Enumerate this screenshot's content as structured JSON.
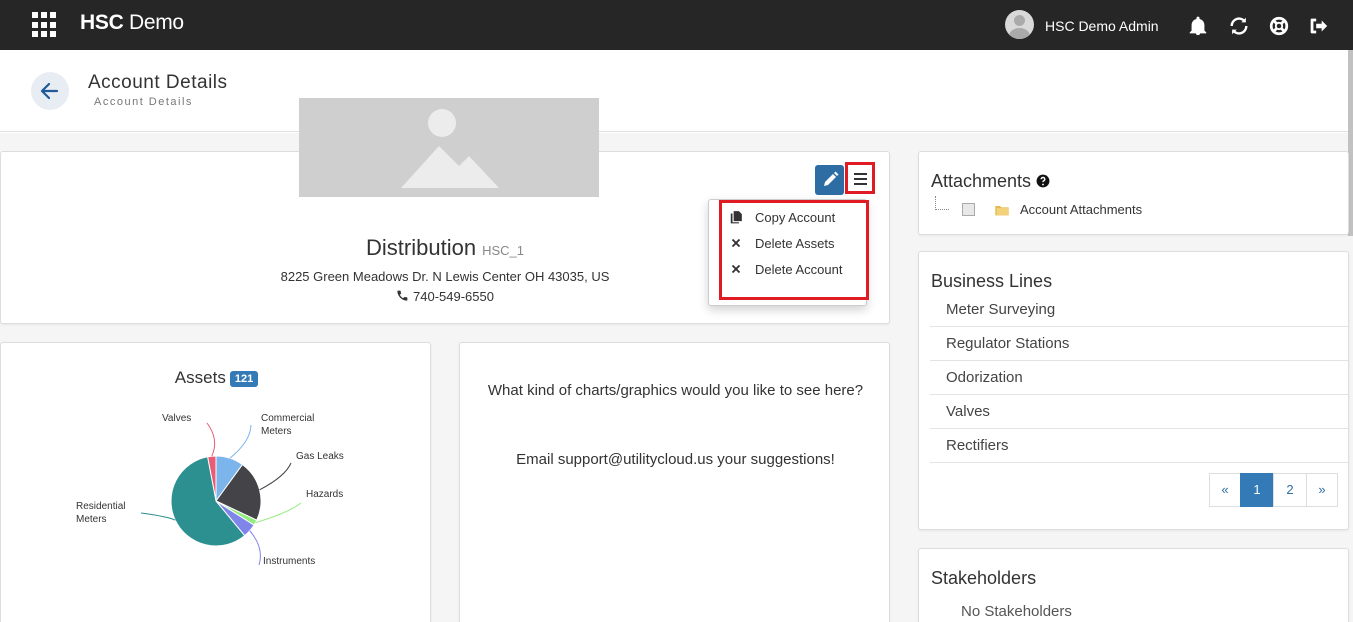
{
  "topbar": {
    "brand_bold": "HSC",
    "brand_rest": " Demo",
    "user_name": "HSC Demo Admin",
    "icons": [
      "apps-grid-icon",
      "bell-icon",
      "refresh-icon",
      "lifebuoy-icon",
      "logout-icon"
    ]
  },
  "header": {
    "title": "Account Details",
    "subtitle": "Account Details"
  },
  "account": {
    "name": "Distribution",
    "code": "HSC_1",
    "address": "8225 Green Meadows Dr. N Lewis Center OH 43035, US",
    "phone": "740-549-6550"
  },
  "menu": {
    "items": [
      {
        "label": "Copy Account",
        "icon": "copy-icon"
      },
      {
        "label": "Delete Assets",
        "icon": "close-icon"
      },
      {
        "label": "Delete Account",
        "icon": "close-icon"
      }
    ]
  },
  "assets": {
    "title": "Assets",
    "count": "121"
  },
  "chart_data": {
    "type": "pie",
    "title": "",
    "categories": [
      "Valves",
      "Commercial Meters",
      "Gas Leaks",
      "Hazards",
      "Instruments",
      "Residential Meters"
    ],
    "values": [
      3,
      10,
      22,
      2,
      5,
      58
    ],
    "labels": [
      "Valves",
      "Commercial\nMeters",
      "Gas Leaks",
      "Hazards",
      "Instruments",
      "Residential\nMeters"
    ],
    "colors": [
      "#e85d75",
      "#7cb5ec",
      "#434348",
      "#90ed7d",
      "#8085e9",
      "#2b908f"
    ]
  },
  "suggestions": {
    "question": "What kind of charts/graphics would you like to see here?",
    "email": "Email support@utilitycloud.us your suggestions!"
  },
  "attachments": {
    "title": "Attachments",
    "item": "Account Attachments"
  },
  "business_lines": {
    "title": "Business Lines",
    "items": [
      "Meter Surveying",
      "Regulator Stations",
      "Odorization",
      "Valves",
      "Rectifiers"
    ],
    "pagination": [
      "«",
      "1",
      "2",
      "»"
    ],
    "current_page": "1"
  },
  "stakeholders": {
    "title": "Stakeholders",
    "empty": "No Stakeholders"
  },
  "colors": {
    "topbar": "#262626",
    "primary": "#337ab7",
    "highlight": "#e01b24"
  }
}
